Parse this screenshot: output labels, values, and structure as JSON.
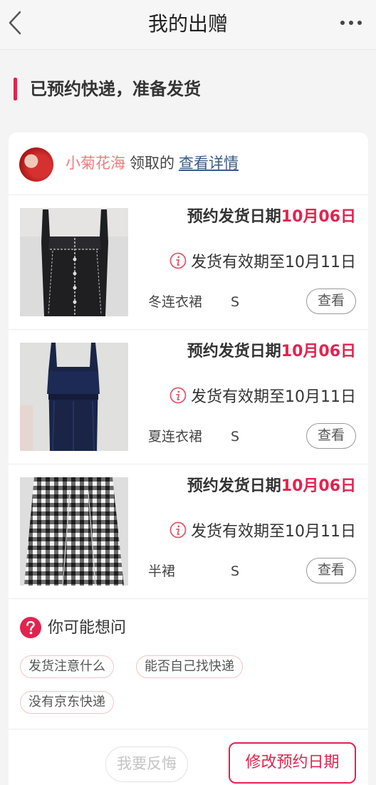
{
  "nav": {
    "title": "我的出赠",
    "back_icon": "chevron-left-icon",
    "more_icon": "more-horizontal-icon"
  },
  "status": {
    "text": "已预约快递，准备发货",
    "accent": "#e2234f"
  },
  "receiver": {
    "name": "小菊花海",
    "action": "领取的",
    "link": "查看详情"
  },
  "items": [
    {
      "schedule_label": "预约发货日期",
      "schedule_date": "10月06日",
      "valid_text": "发货有效期至10月11日",
      "name": "冬连衣裙",
      "size": "S",
      "view_label": "查看",
      "image": "black-dress-with-white-stitching"
    },
    {
      "schedule_label": "预约发货日期",
      "schedule_date": "10月06日",
      "valid_text": "发货有效期至10月11日",
      "name": "夏连衣裙",
      "size": "S",
      "view_label": "查看",
      "image": "navy-strap-dress"
    },
    {
      "schedule_label": "预约发货日期",
      "schedule_date": "10月06日",
      "valid_text": "发货有效期至10月11日",
      "name": "半裙",
      "size": "S",
      "view_label": "查看",
      "image": "gingham-skirt"
    }
  ],
  "faq": {
    "title": "你可能想问",
    "icon": "question-circle-icon",
    "chips": [
      "发货注意什么",
      "能否自己找快递",
      "没有京东快递"
    ]
  },
  "actions": {
    "regret": "我要反悔",
    "modify": "修改预约日期"
  }
}
